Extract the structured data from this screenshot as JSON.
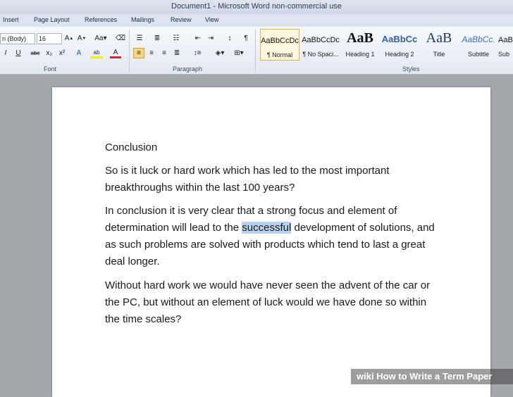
{
  "window": {
    "title": "Document1 - Microsoft Word non-commercial use"
  },
  "tabs": [
    "Insert",
    "Page Layout",
    "References",
    "Mailings",
    "Review",
    "View"
  ],
  "font": {
    "name": "ri (Body)",
    "size": "16",
    "group_label": "Font"
  },
  "paragraph": {
    "group_label": "Paragraph"
  },
  "styles": {
    "group_label": "Styles",
    "items": [
      {
        "preview": "AaBbCcDc",
        "name": "¶ Normal"
      },
      {
        "preview": "AaBbCcDc",
        "name": "¶ No Spaci..."
      },
      {
        "preview": "AaB",
        "name": "Heading 1"
      },
      {
        "preview": "AaBbCc",
        "name": "Heading 2"
      },
      {
        "preview": "AaB",
        "name": "Title"
      },
      {
        "preview": "AaBbCc.",
        "name": "Subtitle"
      },
      {
        "preview": "AaBbCcDc",
        "name": "Sub"
      }
    ]
  },
  "document": {
    "heading": "Conclusion",
    "p1": "So is it luck or hard work which has led to the most important breakthroughs within the last 100 years?",
    "p2_before": "In conclusion it is very clear that a strong focus and element of determination will lead to the ",
    "p2_selected": "successful",
    "p2_after": " development of solutions, and as such problems are solved with products which tend to last a great deal longer.",
    "p3": "Without hard work we would have never seen the advent of the car or the PC, but without an element of luck would we have done so within the time scales?"
  },
  "watermark": {
    "brand": "wiki",
    "text": "How to Write a Term Paper"
  }
}
